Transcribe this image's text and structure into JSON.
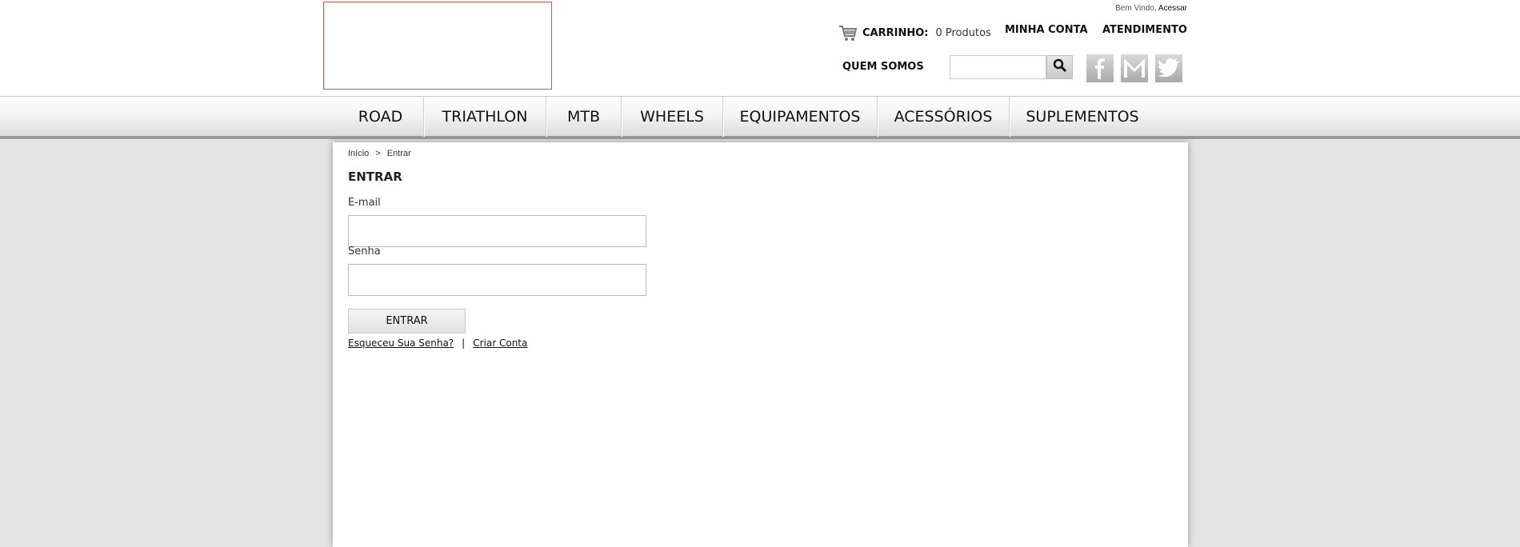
{
  "header": {
    "welcome_text": "Bem Vindo,",
    "welcome_link": "Acessar",
    "cart_label": "CARRINHO:",
    "cart_count": "0 Produtos",
    "my_account": "MINHA CONTA",
    "support": "ATENDIMENTO",
    "about": "QUEM SOMOS",
    "search_placeholder": ""
  },
  "social": [
    "facebook-icon",
    "gmail-icon",
    "twitter-icon"
  ],
  "nav": {
    "items": [
      {
        "label": "ROAD"
      },
      {
        "label": "TRIATHLON"
      },
      {
        "label": "MTB"
      },
      {
        "label": "WHEELS"
      },
      {
        "label": "EQUIPAMENTOS"
      },
      {
        "label": "ACESSÓRIOS"
      },
      {
        "label": "SUPLEMENTOS"
      }
    ]
  },
  "breadcrumb": {
    "home": "Início",
    "separator": ">",
    "current": "Entrar"
  },
  "login": {
    "title": "ENTRAR",
    "email_label": "E-mail",
    "email_value": "",
    "password_label": "Senha",
    "password_value": "",
    "submit_label": "ENTRAR",
    "forgot_link": "Esqueceu Sua Senha?",
    "link_separator": "|",
    "create_link": "Criar Conta"
  },
  "colors": {
    "logo_border": "#e0533f",
    "page_background": "#e4e4e4"
  }
}
